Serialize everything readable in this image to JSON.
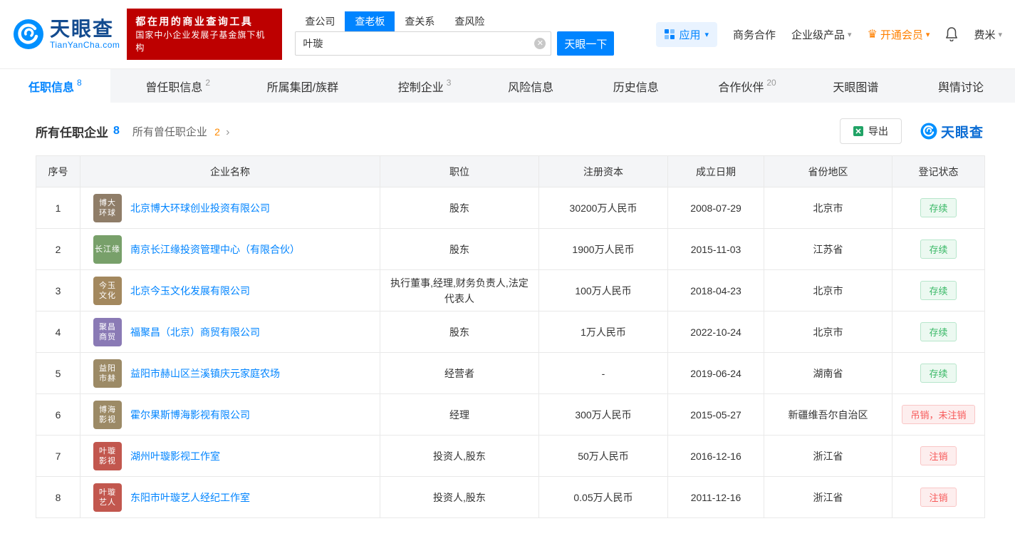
{
  "header": {
    "logo": {
      "brand": "天眼查",
      "domain": "TianYanCha.com"
    },
    "slogan": {
      "line1": "都在用的商业查询工具",
      "line2": "国家中小企业发展子基金旗下机构"
    },
    "search": {
      "tabs": [
        {
          "label": "查公司"
        },
        {
          "label": "查老板"
        },
        {
          "label": "查关系"
        },
        {
          "label": "查风险"
        }
      ],
      "value": "叶璇",
      "button_label": "天眼一下"
    },
    "nav": {
      "apps": "应用",
      "cooperation": "商务合作",
      "enterprise": "企业级产品",
      "vip": "开通会员",
      "user": "费米"
    }
  },
  "tabs": [
    {
      "label": "任职信息",
      "count": "8"
    },
    {
      "label": "曾任职信息",
      "count": "2"
    },
    {
      "label": "所属集团/族群",
      "count": ""
    },
    {
      "label": "控制企业",
      "count": "3"
    },
    {
      "label": "风险信息",
      "count": ""
    },
    {
      "label": "历史信息",
      "count": ""
    },
    {
      "label": "合作伙伴",
      "count": "20"
    },
    {
      "label": "天眼图谱",
      "count": ""
    },
    {
      "label": "舆情讨论",
      "count": ""
    }
  ],
  "section": {
    "title": "所有任职企业",
    "title_count": "8",
    "subtitle": "所有曾任职企业",
    "subtitle_count": "2",
    "chevron": "›",
    "export_label": "导出",
    "watermark": "天眼查"
  },
  "table": {
    "headers": [
      "序号",
      "企业名称",
      "职位",
      "注册资本",
      "成立日期",
      "省份地区",
      "登记状态"
    ],
    "rows": [
      {
        "no": "1",
        "logo_line1": "博大",
        "logo_line2": "环球",
        "logo_color": "#8f7d68",
        "name": "北京博大环球创业投资有限公司",
        "position": "股东",
        "capital": "30200万人民币",
        "date": "2008-07-29",
        "region": "北京市",
        "status": "存续",
        "status_type": "green"
      },
      {
        "no": "2",
        "logo_line1": "长江缘",
        "logo_line2": "",
        "logo_color": "#78a06a",
        "name": "南京长江缘投资管理中心（有限合伙）",
        "position": "股东",
        "capital": "1900万人民币",
        "date": "2015-11-03",
        "region": "江苏省",
        "status": "存续",
        "status_type": "green"
      },
      {
        "no": "3",
        "logo_line1": "今玉",
        "logo_line2": "文化",
        "logo_color": "#a3885e",
        "name": "北京今玉文化发展有限公司",
        "position": "执行董事,经理,财务负责人,法定代表人",
        "capital": "100万人民币",
        "date": "2018-04-23",
        "region": "北京市",
        "status": "存续",
        "status_type": "green"
      },
      {
        "no": "4",
        "logo_line1": "聚昌",
        "logo_line2": "商贸",
        "logo_color": "#8a7ab5",
        "name": "福聚昌（北京）商贸有限公司",
        "position": "股东",
        "capital": "1万人民币",
        "date": "2022-10-24",
        "region": "北京市",
        "status": "存续",
        "status_type": "green"
      },
      {
        "no": "5",
        "logo_line1": "益阳",
        "logo_line2": "市赫",
        "logo_color": "#9c8a66",
        "name": "益阳市赫山区兰溪镇庆元家庭农场",
        "position": "经营者",
        "capital": "-",
        "date": "2019-06-24",
        "region": "湖南省",
        "status": "存续",
        "status_type": "green"
      },
      {
        "no": "6",
        "logo_line1": "博海",
        "logo_line2": "影视",
        "logo_color": "#9c8a66",
        "name": "霍尔果斯博海影视有限公司",
        "position": "经理",
        "capital": "300万人民币",
        "date": "2015-05-27",
        "region": "新疆维吾尔自治区",
        "status": "吊销，未注销",
        "status_type": "red"
      },
      {
        "no": "7",
        "logo_line1": "叶璇",
        "logo_line2": "影视",
        "logo_color": "#c2574e",
        "name": "湖州叶璇影视工作室",
        "position": "投资人,股东",
        "capital": "50万人民币",
        "date": "2016-12-16",
        "region": "浙江省",
        "status": "注销",
        "status_type": "red"
      },
      {
        "no": "8",
        "logo_line1": "叶璇",
        "logo_line2": "艺人",
        "logo_color": "#c2574e",
        "name": "东阳市叶璇艺人经纪工作室",
        "position": "投资人,股东",
        "capital": "0.05万人民币",
        "date": "2011-12-16",
        "region": "浙江省",
        "status": "注销",
        "status_type": "red"
      }
    ]
  },
  "colors": {
    "brand_blue": "#0084ff",
    "slogan_red": "#bd0000",
    "vip_orange": "#ff8000",
    "status_green": "#38b865",
    "status_red": "#f75959"
  }
}
